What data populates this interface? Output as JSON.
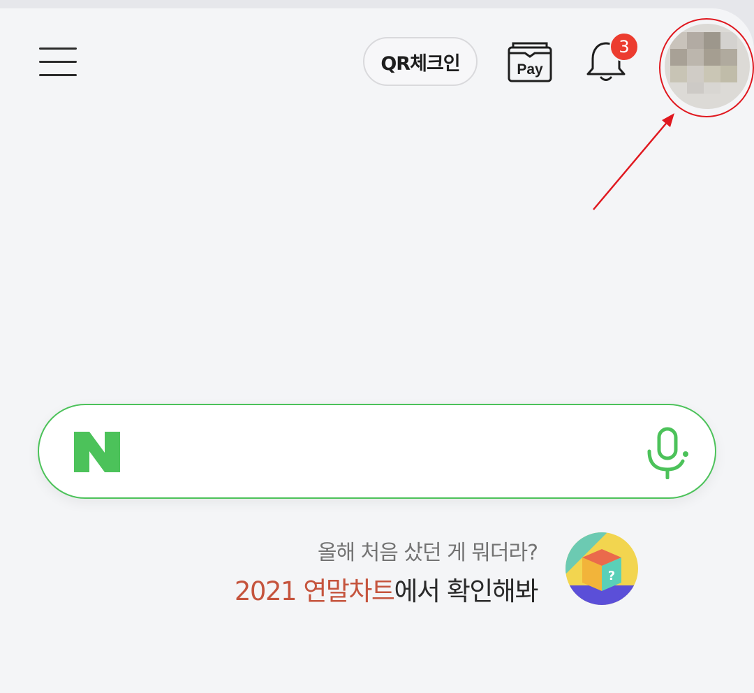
{
  "header": {
    "menu_icon": "hamburger-menu-icon",
    "qr_checkin_label": "QR체크인",
    "pay_label": "Pay",
    "notification_count": "3",
    "bell_icon": "bell-icon",
    "avatar_icon": "profile-avatar"
  },
  "search": {
    "logo_text": "N",
    "placeholder": "",
    "mic_icon": "microphone-icon"
  },
  "promo": {
    "line1": "올해 처음 샀던 게 뭐더라?",
    "highlight": "2021 연말차트",
    "rest": "에서 확인해봐",
    "icon": "mystery-box-icon"
  },
  "colors": {
    "brand_green": "#4cc25a",
    "badge_red": "#ec3c2f",
    "highlight_orange": "#c5543d",
    "annotation_red": "#e0181f"
  }
}
